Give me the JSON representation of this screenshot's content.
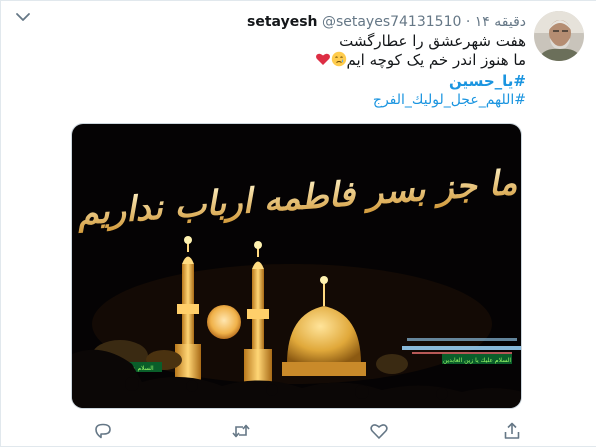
{
  "tweet": {
    "author_name": "setayesh",
    "handle": "@setayes74131510",
    "separator": "·",
    "time": "۱۴ دقیقه",
    "lines": [
      "هفت شهرعشق را عطارگشت",
      "ما هنوز اندر خم یک کوچه ایم"
    ],
    "hashtags": [
      "#یا_حسین",
      "#اللهم_عجل_لولیك_الفرج"
    ]
  },
  "media": {
    "calligraphy": "ما جز بسر فاطمه ارباب نداریم",
    "banner_left": "السلام عليك يا حسين",
    "banner_right": "السلام عليك يا زين العابدين"
  },
  "icons": {
    "caret": "chevron-down-icon",
    "share": "share-icon",
    "like": "heart-icon",
    "retweet": "retweet-icon",
    "reply": "reply-icon",
    "tear_emoji": "crying-face-icon",
    "heart_emoji": "red-heart-icon"
  },
  "colors": {
    "text": "#14171a",
    "secondary": "#657786",
    "link": "#1b95e0",
    "heart": "#e0245e"
  }
}
